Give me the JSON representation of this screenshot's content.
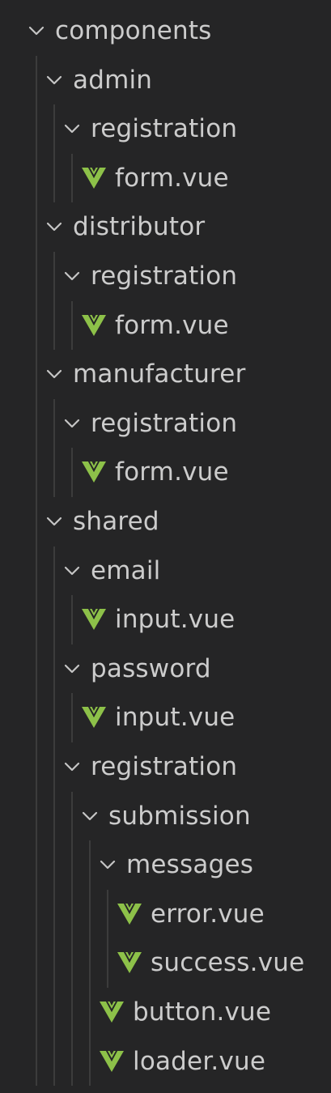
{
  "theme": {
    "background": "#252526",
    "text": "#cccccc",
    "chevron": "#c5c5c5",
    "guide": "#3c3c3c",
    "vue_icon": "#8dc149"
  },
  "explorer": {
    "items": [
      {
        "label": "components",
        "type": "folder",
        "level": 0,
        "expanded": true,
        "icon": "chevron-down-icon"
      },
      {
        "label": "admin",
        "type": "folder",
        "level": 1,
        "expanded": true,
        "icon": "chevron-down-icon"
      },
      {
        "label": "registration",
        "type": "folder",
        "level": 2,
        "expanded": true,
        "icon": "chevron-down-icon"
      },
      {
        "label": "form.vue",
        "type": "file",
        "level": 3,
        "icon": "vue-file-icon"
      },
      {
        "label": "distributor",
        "type": "folder",
        "level": 1,
        "expanded": true,
        "icon": "chevron-down-icon"
      },
      {
        "label": "registration",
        "type": "folder",
        "level": 2,
        "expanded": true,
        "icon": "chevron-down-icon"
      },
      {
        "label": "form.vue",
        "type": "file",
        "level": 3,
        "icon": "vue-file-icon"
      },
      {
        "label": "manufacturer",
        "type": "folder",
        "level": 1,
        "expanded": true,
        "icon": "chevron-down-icon"
      },
      {
        "label": "registration",
        "type": "folder",
        "level": 2,
        "expanded": true,
        "icon": "chevron-down-icon"
      },
      {
        "label": "form.vue",
        "type": "file",
        "level": 3,
        "icon": "vue-file-icon"
      },
      {
        "label": "shared",
        "type": "folder",
        "level": 1,
        "expanded": true,
        "icon": "chevron-down-icon"
      },
      {
        "label": "email",
        "type": "folder",
        "level": 2,
        "expanded": true,
        "icon": "chevron-down-icon"
      },
      {
        "label": "input.vue",
        "type": "file",
        "level": 3,
        "icon": "vue-file-icon"
      },
      {
        "label": "password",
        "type": "folder",
        "level": 2,
        "expanded": true,
        "icon": "chevron-down-icon"
      },
      {
        "label": "input.vue",
        "type": "file",
        "level": 3,
        "icon": "vue-file-icon"
      },
      {
        "label": "registration",
        "type": "folder",
        "level": 2,
        "expanded": true,
        "icon": "chevron-down-icon"
      },
      {
        "label": "submission",
        "type": "folder",
        "level": 3,
        "expanded": true,
        "icon": "chevron-down-icon"
      },
      {
        "label": "messages",
        "type": "folder",
        "level": 4,
        "expanded": true,
        "icon": "chevron-down-icon"
      },
      {
        "label": "error.vue",
        "type": "file",
        "level": 5,
        "icon": "vue-file-icon"
      },
      {
        "label": "success.vue",
        "type": "file",
        "level": 5,
        "icon": "vue-file-icon"
      },
      {
        "label": "button.vue",
        "type": "file",
        "level": 4,
        "icon": "vue-file-icon"
      },
      {
        "label": "loader.vue",
        "type": "file",
        "level": 4,
        "icon": "vue-file-icon"
      }
    ]
  }
}
